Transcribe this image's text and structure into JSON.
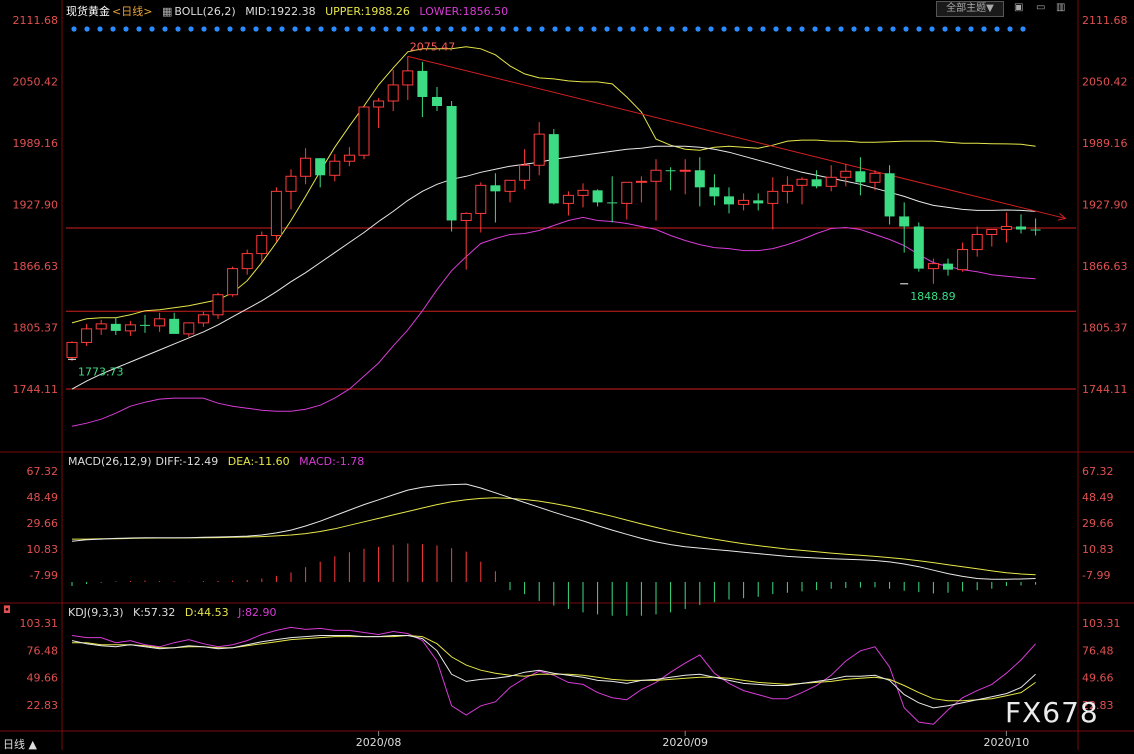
{
  "header": {
    "instrument": "现货黄金",
    "period": "<日线>",
    "boll_label": "BOLL(26,2)",
    "mid_label": "MID:1922.38",
    "upper_label": "UPPER:1988.26",
    "lower_label": "LOWER:1856.50",
    "theme_button": "全部主题▼"
  },
  "macd_header": {
    "title": "MACD(26,12,9)",
    "diff": "DIFF:-12.49",
    "dea": "DEA:-11.60",
    "macd": "MACD:-1.78"
  },
  "kdj_header": {
    "title": "KDJ(9,3,3)",
    "k": "K:57.32",
    "d": "D:44.53",
    "j": "J:82.90"
  },
  "bottom_tab": "日线 ▲",
  "watermark": "FX678",
  "colors": {
    "up": "#ff3b3b",
    "down": "#3ddc84",
    "mid": "#e8e8e8",
    "upper": "#e6e64a",
    "lower": "#d63cd6",
    "hline": "#d02020",
    "grid": "#7a0a0a",
    "axis_text": "#e05050",
    "macd_dea": "#e6e64a",
    "kdj_j": "#d63cd6"
  },
  "chart_data": [
    {
      "type": "candlestick",
      "title": "现货黄金",
      "yticks": [
        "2111.68",
        "2050.42",
        "1989.16",
        "1927.90",
        "1866.63",
        "1805.37",
        "1744.11"
      ],
      "ylim": [
        1744.11,
        2111.68
      ],
      "xticks": [
        {
          "index": 21,
          "label": "2020/08"
        },
        {
          "index": 42,
          "label": "2020/09"
        },
        {
          "index": 64,
          "label": "2020/10"
        }
      ],
      "annotations": [
        {
          "text": "2075.47",
          "index": 23,
          "value": 2075.47
        },
        {
          "text": "1773.73",
          "index": 0,
          "value": 1773.73
        },
        {
          "text": "1848.89",
          "index": 57,
          "value": 1848.89
        }
      ],
      "horizontal_lines": [
        1904.5,
        1821.5,
        1744.11
      ],
      "trendline": {
        "from": {
          "index": 23,
          "value": 2075.47
        },
        "to": {
          "index": 66,
          "value": 1914
        }
      },
      "candles": [
        [
          1775.5,
          1791.5,
          1772,
          1790.5
        ],
        [
          1790.5,
          1809,
          1787,
          1804
        ],
        [
          1804,
          1813,
          1798,
          1809
        ],
        [
          1809,
          1815,
          1798,
          1802
        ],
        [
          1802,
          1812,
          1797,
          1808
        ],
        [
          1808,
          1818,
          1800,
          1807
        ],
        [
          1807,
          1820,
          1801,
          1814
        ],
        [
          1814,
          1820,
          1801,
          1799
        ],
        [
          1799,
          1808,
          1796,
          1810
        ],
        [
          1810,
          1821,
          1806,
          1818
        ],
        [
          1818,
          1840,
          1814,
          1838
        ],
        [
          1838,
          1866,
          1836,
          1864
        ],
        [
          1864,
          1883,
          1858,
          1879
        ],
        [
          1879,
          1901,
          1871,
          1897
        ],
        [
          1897,
          1945,
          1891,
          1941
        ],
        [
          1941,
          1963,
          1923,
          1956
        ],
        [
          1956,
          1984,
          1948,
          1974
        ],
        [
          1974,
          1969,
          1945,
          1957
        ],
        [
          1957,
          1978,
          1951,
          1971
        ],
        [
          1971,
          1985,
          1966,
          1977
        ],
        [
          1977,
          2014,
          1973,
          2025
        ],
        [
          2025,
          2034,
          2004,
          2031
        ],
        [
          2031,
          2062,
          2021,
          2047
        ],
        [
          2047,
          2075.47,
          2032,
          2061
        ],
        [
          2061,
          2070,
          2015,
          2035
        ],
        [
          2035,
          2045,
          2021,
          2026
        ],
        [
          2026,
          2031,
          1901,
          1912
        ],
        [
          1912,
          1920,
          1863,
          1919
        ],
        [
          1919,
          1950,
          1900,
          1947
        ],
        [
          1947,
          1959,
          1910,
          1941
        ],
        [
          1941,
          1950,
          1930,
          1952
        ],
        [
          1952,
          1983,
          1943,
          1967
        ],
        [
          1967,
          2010,
          1957,
          1998
        ],
        [
          1998,
          2003,
          1928,
          1929
        ],
        [
          1929,
          1941,
          1917,
          1937
        ],
        [
          1937,
          1949,
          1925,
          1942
        ],
        [
          1942,
          1943,
          1926,
          1930
        ],
        [
          1930,
          1956,
          1910,
          1929
        ],
        [
          1929,
          1948,
          1913,
          1950
        ],
        [
          1950,
          1956,
          1930,
          1951
        ],
        [
          1951,
          1973,
          1912,
          1962
        ],
        [
          1962,
          1965,
          1942,
          1961
        ],
        [
          1961,
          1973,
          1938,
          1962
        ],
        [
          1962,
          1975,
          1926,
          1945
        ],
        [
          1945,
          1958,
          1927,
          1936
        ],
        [
          1936,
          1945,
          1919,
          1928
        ],
        [
          1928,
          1939,
          1922,
          1932
        ],
        [
          1932,
          1939,
          1922,
          1929
        ],
        [
          1929,
          1955,
          1903,
          1941
        ],
        [
          1941,
          1956,
          1929,
          1947
        ],
        [
          1947,
          1955,
          1928,
          1953
        ],
        [
          1953,
          1962,
          1944,
          1946
        ],
        [
          1946,
          1967,
          1941,
          1955
        ],
        [
          1955,
          1968,
          1946,
          1961
        ],
        [
          1961,
          1975,
          1937,
          1950
        ],
        [
          1950,
          1962,
          1942,
          1959
        ],
        [
          1959,
          1967,
          1908,
          1916
        ],
        [
          1916,
          1930,
          1880,
          1906
        ],
        [
          1906,
          1910,
          1861,
          1864
        ],
        [
          1864,
          1874,
          1848.89,
          1869
        ],
        [
          1869,
          1874,
          1857,
          1863
        ],
        [
          1863,
          1890,
          1861,
          1883
        ],
        [
          1883,
          1906,
          1876,
          1898
        ],
        [
          1898,
          1902,
          1886,
          1903
        ],
        [
          1903,
          1920,
          1890,
          1906
        ],
        [
          1906,
          1918,
          1899,
          1903
        ],
        [
          1903,
          1914,
          1897,
          1902
        ]
      ],
      "series": [
        {
          "name": "MID",
          "values": [
            1744,
            1752,
            1759,
            1765,
            1771,
            1777,
            1783,
            1789,
            1795,
            1801,
            1808,
            1816,
            1824,
            1832,
            1841,
            1851,
            1860,
            1870,
            1880,
            1890,
            1900,
            1911,
            1921,
            1932,
            1941,
            1948,
            1953,
            1956,
            1960,
            1963,
            1966,
            1968,
            1970,
            1973,
            1975,
            1977,
            1979,
            1981,
            1983,
            1984,
            1986,
            1986,
            1986,
            1985,
            1983,
            1980,
            1976,
            1972,
            1968,
            1964,
            1960,
            1957,
            1954,
            1951,
            1948,
            1944,
            1940,
            1936,
            1931,
            1927,
            1925,
            1923,
            1922,
            1922,
            1922.38,
            1922,
            1921
          ]
        },
        {
          "name": "UPPER",
          "values": [
            1810,
            1814,
            1815,
            1815,
            1818,
            1822,
            1823,
            1825,
            1827,
            1830,
            1833,
            1840,
            1852,
            1870,
            1890,
            1912,
            1936,
            1961,
            1985,
            2006,
            2026,
            2047,
            2064,
            2080,
            2083,
            2083,
            2083,
            2085,
            2083,
            2077,
            2066,
            2058,
            2054,
            2053,
            2051,
            2050,
            2050,
            2048,
            2035,
            2020,
            1993,
            1987,
            1983,
            1982,
            1985,
            1986,
            1985,
            1984,
            1987,
            1991,
            1992,
            1992,
            1991,
            1991,
            1990,
            1990,
            1990.5,
            1991,
            1991,
            1991,
            1990,
            1989,
            1989,
            1988.5,
            1988.26,
            1988,
            1986
          ]
        },
        {
          "name": "LOWER",
          "values": [
            1707,
            1710,
            1714,
            1720,
            1727,
            1731,
            1734,
            1735,
            1735,
            1735,
            1730,
            1727,
            1725,
            1723,
            1722,
            1722,
            1724,
            1728,
            1735,
            1744,
            1757,
            1770,
            1787,
            1803,
            1822,
            1843,
            1862,
            1876,
            1889,
            1894,
            1898,
            1899,
            1902,
            1907,
            1912,
            1915,
            1912,
            1911,
            1909,
            1906,
            1903,
            1897,
            1892,
            1888,
            1885,
            1884,
            1882,
            1882,
            1884,
            1888,
            1893,
            1899,
            1904,
            1905,
            1903,
            1898,
            1893,
            1887,
            1878,
            1870,
            1866,
            1863,
            1861,
            1858,
            1856.5,
            1855,
            1854
          ]
        }
      ],
      "line_slopes_hint": "none"
    },
    {
      "type": "bar+line",
      "title": "MACD(26,12,9)",
      "yticks": [
        "67.32",
        "48.49",
        "29.66",
        "10.83",
        "-7.99"
      ],
      "ylim": [
        -20.0,
        72.0
      ],
      "series": [
        {
          "name": "DIFF",
          "values": [
            16.5,
            17.5,
            18,
            18.5,
            18.8,
            19,
            19,
            19,
            19,
            19.3,
            19.5,
            19.8,
            20.2,
            21,
            22.5,
            24.5,
            27.5,
            31,
            35,
            39,
            43,
            46.5,
            50,
            53.5,
            55.5,
            56.8,
            57.5,
            57.8,
            55,
            51.5,
            48,
            44.5,
            41,
            37.5,
            34.2,
            31.2,
            27.8,
            24.5,
            21.5,
            18.5,
            16,
            14,
            12.5,
            11.5,
            10.5,
            9.5,
            8.5,
            7.5,
            6.5,
            5.5,
            4.8,
            4.3,
            3.8,
            3.4,
            3,
            2.5,
            1.5,
            0,
            -2,
            -4.5,
            -7,
            -9,
            -10.5,
            -11,
            -11,
            -10.9,
            -10.5
          ]
        },
        {
          "name": "DEA",
          "values": [
            18,
            18,
            18.2,
            18.3,
            18.5,
            18.7,
            18.8,
            18.8,
            18.9,
            19,
            19.1,
            19.3,
            19.5,
            19.8,
            20.3,
            21,
            22,
            23.5,
            25.5,
            28,
            30.5,
            33,
            35.5,
            38,
            40.5,
            43,
            45,
            46.5,
            47.5,
            48,
            47.5,
            46.7,
            45.5,
            43.8,
            41.8,
            39.5,
            37,
            34.5,
            31.8,
            29,
            26.5,
            24,
            21.8,
            19.8,
            18,
            16.3,
            14.7,
            13.3,
            12,
            10.8,
            9.8,
            8.8,
            7.9,
            7.1,
            6.3,
            5.5,
            4.6,
            3.6,
            2.4,
            1,
            -0.5,
            -2,
            -3.5,
            -5,
            -6.3,
            -7.3,
            -7.8
          ]
        },
        {
          "name": "MACD",
          "values": [
            -3,
            -1.5,
            -0.5,
            0.5,
            0.8,
            1,
            0.6,
            0.5,
            0.2,
            0.6,
            0.8,
            1,
            1.5,
            2.5,
            4.5,
            7,
            11,
            15,
            19,
            22,
            24.5,
            26,
            27.5,
            28.5,
            28,
            27,
            25,
            22.5,
            15,
            8,
            -6,
            -9,
            -14,
            -17.5,
            -20,
            -22.5,
            -24,
            -25,
            -25,
            -25,
            -24,
            -22.5,
            -20,
            -17,
            -15,
            -13,
            -12,
            -11,
            -9,
            -8,
            -7,
            -6,
            -5,
            -4.5,
            -4.2,
            -4,
            -5,
            -6.5,
            -7.5,
            -8.5,
            -8,
            -7,
            -6,
            -5,
            -3,
            -2.5,
            -2
          ]
        }
      ]
    },
    {
      "type": "line",
      "title": "KDJ(9,3,3)",
      "yticks": [
        "103.31",
        "76.48",
        "49.66",
        "22.83"
      ],
      "ylim": [
        0,
        118
      ],
      "series": [
        {
          "name": "K",
          "values": [
            86,
            83,
            81,
            80,
            82,
            80,
            78,
            79,
            81,
            80,
            78,
            79,
            82,
            85,
            87,
            89,
            90,
            91,
            91,
            91,
            90,
            90,
            91,
            91,
            88,
            76,
            53,
            46,
            48,
            49,
            51,
            55,
            57,
            54,
            52,
            50,
            47,
            46,
            44,
            47,
            48,
            50,
            52,
            53,
            50,
            47,
            44,
            43,
            42,
            42,
            44,
            46,
            48,
            51,
            51,
            52,
            47,
            33,
            25,
            20,
            22,
            25,
            28,
            31,
            34,
            40,
            53
          ]
        },
        {
          "name": "D",
          "values": [
            84,
            84,
            82,
            82,
            82,
            81,
            79,
            79,
            80,
            80,
            79,
            79,
            81,
            83,
            85,
            87,
            88,
            89,
            90,
            90,
            90,
            90,
            90,
            91,
            90,
            83,
            70,
            62,
            57,
            54,
            52,
            51,
            53,
            53,
            53,
            52,
            50,
            48,
            47,
            47,
            47,
            48,
            49,
            50,
            50,
            49,
            47,
            45,
            44,
            43,
            44,
            45,
            46,
            48,
            49,
            50,
            48,
            42,
            35,
            29,
            27,
            27,
            28,
            29,
            32,
            35,
            45
          ]
        },
        {
          "name": "J",
          "values": [
            91,
            89,
            89,
            84,
            86,
            82,
            80,
            84,
            87,
            83,
            80,
            82,
            86,
            92,
            96,
            99,
            97,
            98,
            96,
            96,
            94,
            92,
            95,
            93,
            86,
            66,
            22,
            13,
            22,
            26,
            40,
            49,
            56,
            52,
            45,
            43,
            35,
            30,
            28,
            38,
            45,
            55,
            64,
            72,
            54,
            44,
            37,
            33,
            29,
            29,
            35,
            42,
            52,
            66,
            76,
            80,
            60,
            20,
            6,
            4,
            18,
            30,
            37,
            43,
            54,
            67,
            82.9
          ]
        }
      ]
    }
  ]
}
